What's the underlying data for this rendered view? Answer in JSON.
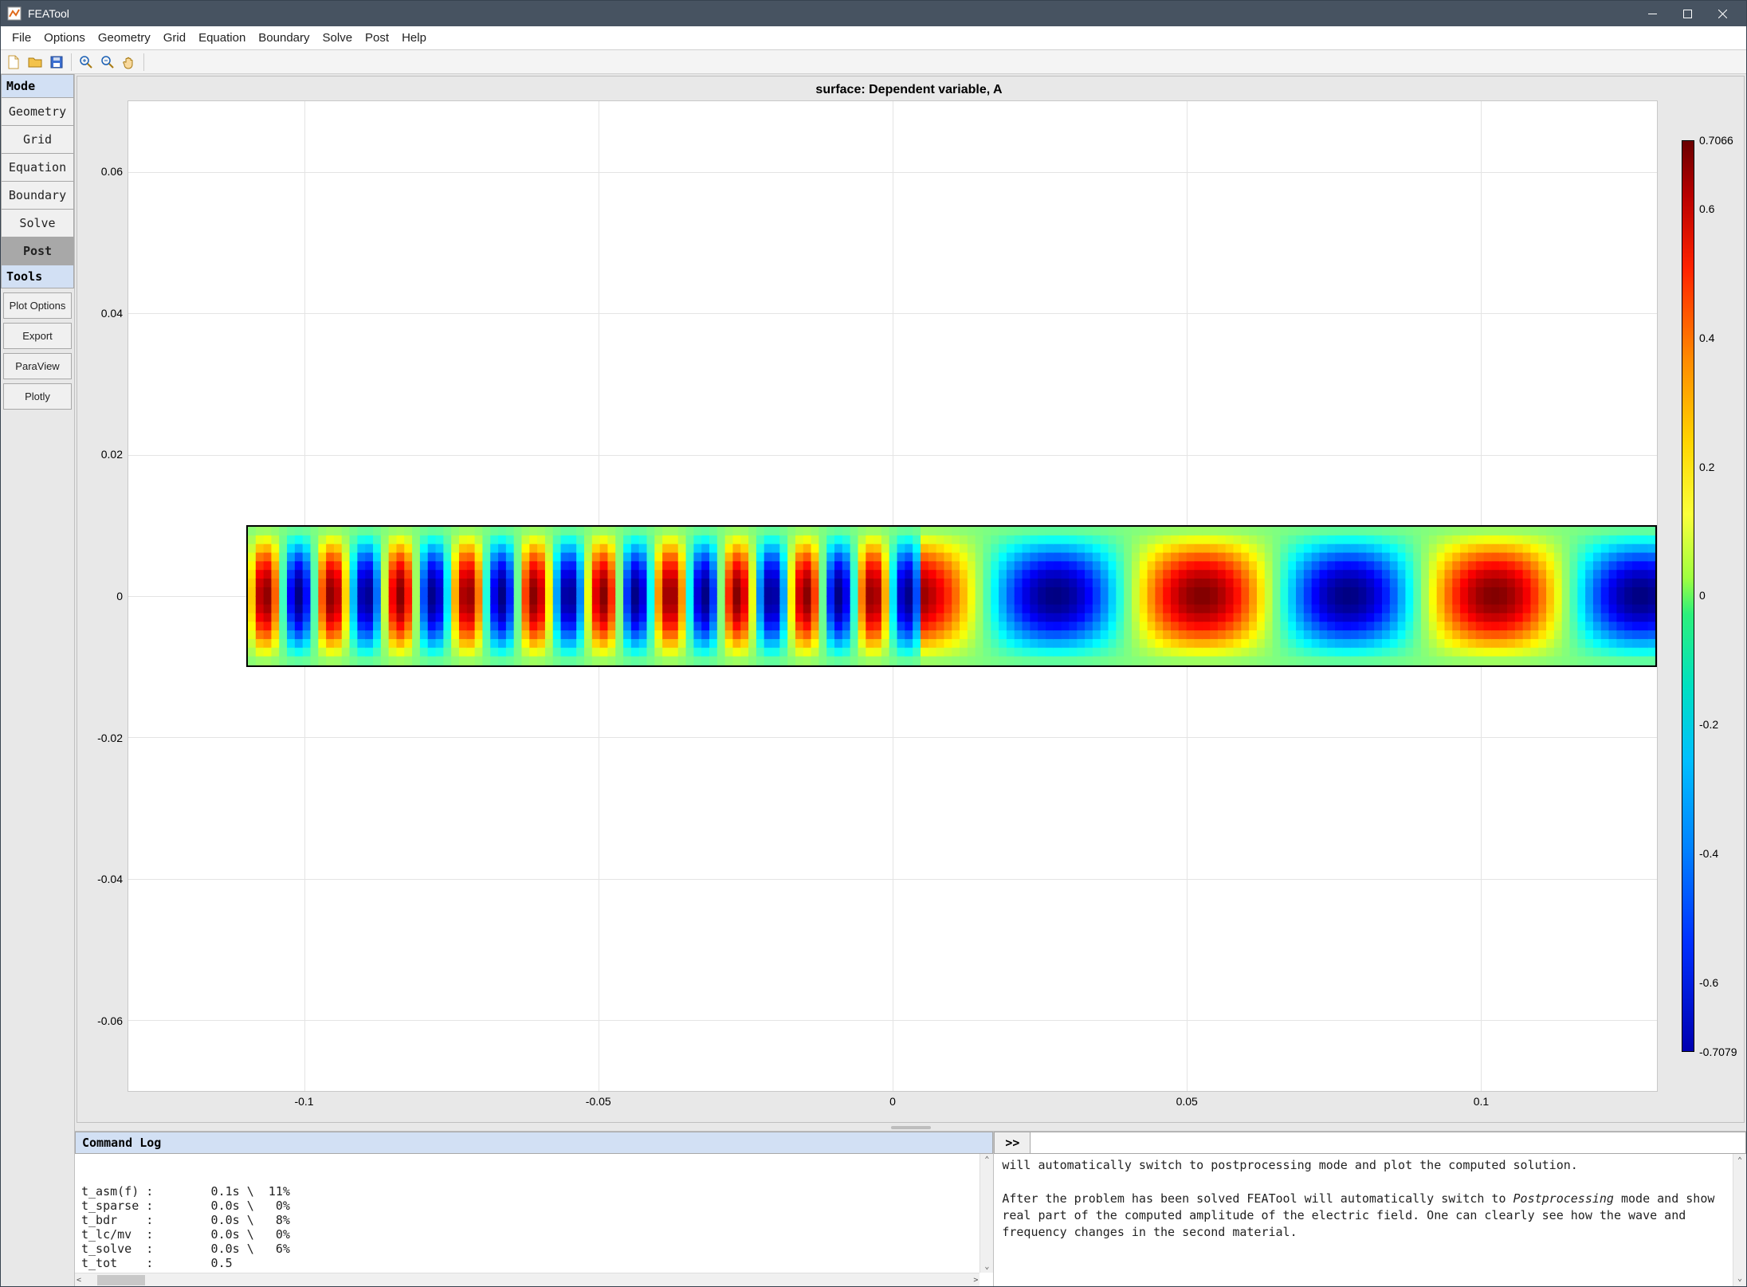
{
  "app": {
    "title": "FEATool"
  },
  "menus": [
    "File",
    "Options",
    "Geometry",
    "Grid",
    "Equation",
    "Boundary",
    "Solve",
    "Post",
    "Help"
  ],
  "toolbar_icons": [
    "new-file-icon",
    "open-file-icon",
    "save-icon",
    "zoom-in-icon",
    "zoom-out-icon",
    "pan-icon"
  ],
  "sidebar": {
    "header_mode": "Mode",
    "modes": [
      {
        "label": "Geometry",
        "active": false
      },
      {
        "label": "Grid",
        "active": false
      },
      {
        "label": "Equation",
        "active": false
      },
      {
        "label": "Boundary",
        "active": false
      },
      {
        "label": "Solve",
        "active": false
      },
      {
        "label": "Post",
        "active": true
      }
    ],
    "header_tools": "Tools",
    "tools": [
      "Plot Options",
      "Export",
      "ParaView",
      "Plotly"
    ]
  },
  "chart_data": {
    "type": "heatmap",
    "title": "surface: Dependent variable, A",
    "xlim": [
      -0.13,
      0.13
    ],
    "ylim": [
      -0.07,
      0.07
    ],
    "xticks": [
      -0.1,
      -0.05,
      0,
      0.05,
      0.1
    ],
    "yticks": [
      -0.06,
      -0.04,
      -0.02,
      0,
      0.02,
      0.04,
      0.06
    ],
    "colorbar": {
      "min": -0.7079,
      "max": 0.7066,
      "ticks": [
        -0.7079,
        -0.6,
        -0.4,
        -0.2,
        0,
        0.2,
        0.4,
        0.6,
        0.7066
      ]
    },
    "domain_rect": {
      "xmin": -0.11,
      "xmax": 0.13,
      "ymin": -0.01,
      "ymax": 0.01
    },
    "description": "Rectangular waveguide; left half fine standing-wave pattern (~10 lobe pairs), right half 5 broad lobes — frequency change at x≈0. Amplitude peaks at y=0, green near y=±0.01."
  },
  "log": {
    "header": "Command Log",
    "lines": [
      "t_asm(f) :        0.1s \\  11%",
      "t_sparse :        0.0s \\   0%",
      "t_bdr    :        0.0s \\   8%",
      "t_lc/mv  :        0.0s \\   0%",
      "t_solve  :        0.0s \\   6%",
      "t_tot    :        0.5",
      "--------------------------------------------"
    ]
  },
  "help": {
    "prompt": ">>",
    "text_pre": "will automatically switch to postprocessing mode and plot the computed solution.",
    "para2_a": "After the problem has been solved FEATool will automatically switch to ",
    "para2_em": "Postprocessing",
    "para2_b": " mode and show real part of the computed amplitude of the electric field. One can clearly see how the wave and frequency changes in the second material."
  }
}
